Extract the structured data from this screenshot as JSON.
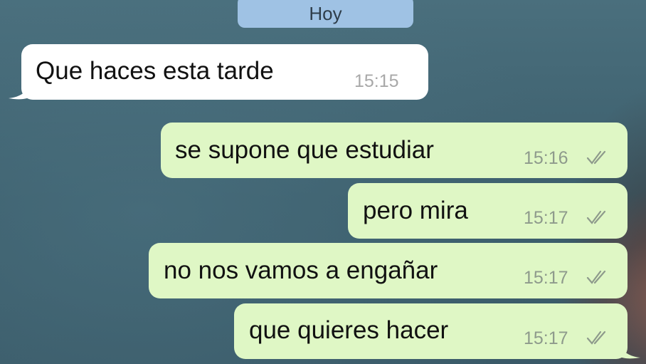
{
  "date_separator": "Hoy",
  "messages": [
    {
      "direction": "incoming",
      "text": "Que haces esta tarde",
      "time": "15:15"
    },
    {
      "direction": "outgoing",
      "text": "se supone que estudiar",
      "time": "15:16",
      "status": "read"
    },
    {
      "direction": "outgoing",
      "text": "pero mira",
      "time": "15:17",
      "status": "read"
    },
    {
      "direction": "outgoing",
      "text": "no nos vamos a engañar",
      "time": "15:17",
      "status": "read"
    },
    {
      "direction": "outgoing",
      "text": "que quieres hacer",
      "time": "15:17",
      "status": "read"
    }
  ],
  "colors": {
    "incoming_bubble": "#ffffff",
    "outgoing_bubble": "#dff7c5",
    "date_pill": "#9fc2e4",
    "background": "#3f6270"
  }
}
